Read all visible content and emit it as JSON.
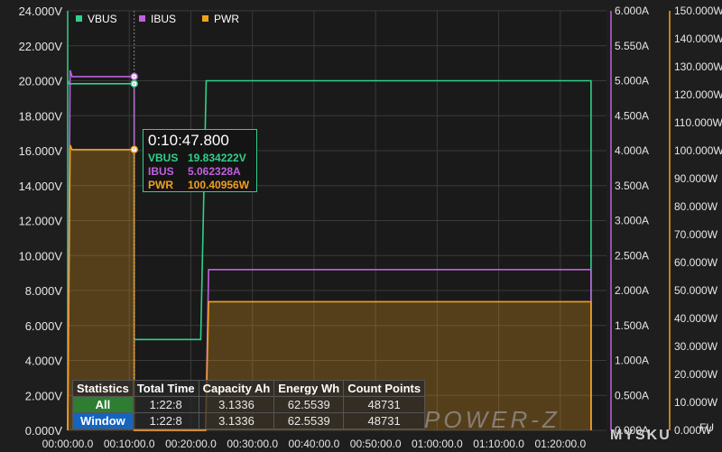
{
  "chart_data": {
    "type": "line",
    "x_ticks": [
      "00:00:00.0",
      "00:10:00.0",
      "00:20:00.0",
      "00:30:00.0",
      "00:40:00.0",
      "00:50:00.0",
      "01:00:00.0",
      "01:10:00.0",
      "01:20:00.0"
    ],
    "x_range_minutes": [
      0,
      87.5
    ],
    "y_left": {
      "range": [
        0,
        24
      ],
      "ticks": [
        "0.000V",
        "2.000V",
        "4.000V",
        "6.000V",
        "8.000V",
        "10.000V",
        "12.000V",
        "14.000V",
        "16.000V",
        "18.000V",
        "20.000V",
        "22.000V",
        "24.000V"
      ]
    },
    "y_right1": {
      "range": [
        0,
        6
      ],
      "ticks": [
        "0.000A",
        "0.500A",
        "1.000A",
        "1.500A",
        "2.000A",
        "2.500A",
        "3.000A",
        "3.500A",
        "4.000A",
        "4.500A",
        "5.000A",
        "5.550A",
        "6.000A"
      ]
    },
    "y_right2": {
      "range": [
        0,
        150
      ],
      "ticks": [
        "0.000W",
        "10.000W",
        "20.000W",
        "30.000W",
        "40.000W",
        "50.000W",
        "60.000W",
        "70.000W",
        "80.000W",
        "90.000W",
        "100.000W",
        "110.000W",
        "120.000W",
        "130.000W",
        "140.000W",
        "150.000W"
      ]
    },
    "legend": [
      {
        "name": "VBUS",
        "color": "#2fd18a"
      },
      {
        "name": "IBUS",
        "color": "#c060e0"
      },
      {
        "name": "PWR",
        "color": "#f0a020"
      }
    ],
    "series": [
      {
        "name": "VBUS",
        "unit": "V",
        "color": "#2fd18a",
        "points": [
          [
            0,
            20.0
          ],
          [
            0.3,
            19.8
          ],
          [
            0.6,
            19.83
          ],
          [
            10.8,
            19.83
          ],
          [
            10.8,
            5.2
          ],
          [
            21.6,
            5.2
          ],
          [
            22.5,
            20.0
          ],
          [
            85.0,
            20.0
          ],
          [
            85.0,
            0.0
          ]
        ]
      },
      {
        "name": "IBUS",
        "unit": "A",
        "color": "#c060e0",
        "points": [
          [
            0,
            0.0
          ],
          [
            0.4,
            5.15
          ],
          [
            0.7,
            5.06
          ],
          [
            10.8,
            5.06
          ],
          [
            10.8,
            0.0
          ],
          [
            22.4,
            0.0
          ],
          [
            22.9,
            2.3
          ],
          [
            85.0,
            2.3
          ],
          [
            85.0,
            0.0
          ]
        ]
      },
      {
        "name": "PWR",
        "unit": "W",
        "color": "#f0a020",
        "points": [
          [
            0,
            0.0
          ],
          [
            0.4,
            102
          ],
          [
            0.7,
            100.4
          ],
          [
            10.8,
            100.4
          ],
          [
            10.8,
            0.0
          ],
          [
            22.4,
            0.0
          ],
          [
            22.9,
            46.0
          ],
          [
            85.0,
            46.0
          ],
          [
            85.0,
            0.0
          ]
        ]
      }
    ]
  },
  "tooltip": {
    "time": "0:10:47.800",
    "rows": [
      {
        "name": "VBUS",
        "value": "19.834222V",
        "color": "#2fd18a"
      },
      {
        "name": "IBUS",
        "value": "5.062328A",
        "color": "#c060e0"
      },
      {
        "name": "PWR",
        "value": "100.40956W",
        "color": "#f0a020"
      }
    ]
  },
  "statistics": {
    "headers": [
      "Statistics",
      "Total Time",
      "Capacity Ah",
      "Energy Wh",
      "Count Points"
    ],
    "rows": [
      {
        "label": "All",
        "total_time": "1:22:8",
        "capacity": "3.1336",
        "energy": "62.5539",
        "count": "48731"
      },
      {
        "label": "Window",
        "total_time": "1:22:8",
        "capacity": "3.1336",
        "energy": "62.5539",
        "count": "48731"
      }
    ]
  },
  "watermark": "POWER-Z",
  "watermark2": "MYSKU",
  "corner_label": "FU"
}
